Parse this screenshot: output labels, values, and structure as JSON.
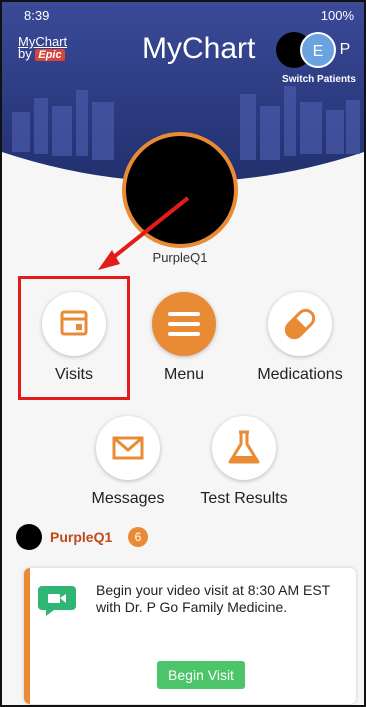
{
  "status": {
    "time": "8:39",
    "battery": "100%"
  },
  "header": {
    "brand_left_line1": "MyChart",
    "brand_left_line2": "by",
    "brand_left_epic": "Epic",
    "title": "MyChart",
    "switch_patients_label": "Switch Patients",
    "switch_initials": [
      "E",
      "P"
    ]
  },
  "patient": {
    "name": "PurpleQ1"
  },
  "tiles": [
    {
      "label": "Visits",
      "icon": "calendar-icon"
    },
    {
      "label": "Menu",
      "icon": "hamburger-icon"
    },
    {
      "label": "Medications",
      "icon": "pill-icon"
    },
    {
      "label": "Messages",
      "icon": "envelope-icon"
    },
    {
      "label": "Test Results",
      "icon": "flask-icon"
    }
  ],
  "feed": {
    "name": "PurpleQ1",
    "badge_count": "6",
    "card_message": "Begin your video visit at 8:30 AM EST with Dr. P Go Family Medicine.",
    "button_label": "Begin Visit"
  },
  "colors": {
    "accent": "#e98b34",
    "header_blue": "#2f3e86",
    "highlight_red": "#e31b1b",
    "button_green": "#4cc46a"
  }
}
